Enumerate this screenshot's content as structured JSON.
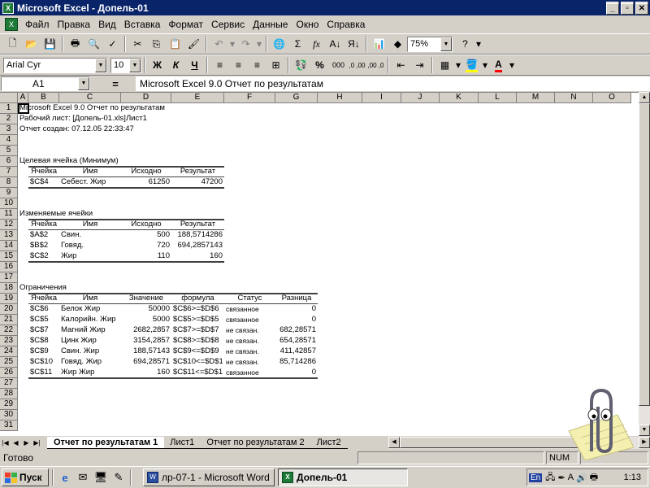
{
  "window": {
    "title": "Microsoft Excel - Допель-01"
  },
  "menu": [
    "Файл",
    "Правка",
    "Вид",
    "Вставка",
    "Формат",
    "Сервис",
    "Данные",
    "Окно",
    "Справка"
  ],
  "toolbar": {
    "zoom": "75%",
    "font_name": "Arial Cyr",
    "font_size": "10",
    "bold": "Ж",
    "italic": "К",
    "underline": "Ч",
    "sum": "Σ",
    "fx": "fx",
    "currency": "%",
    "thousands": "000",
    "inc_dec": ",0 ,00",
    "dec_dec": ",00 ,0",
    "help": "?"
  },
  "formula_bar": {
    "cell_ref": "A1",
    "eq": "=",
    "content": "Microsoft Excel 9.0 Отчет по результатам"
  },
  "columns": [
    "A",
    "B",
    "C",
    "D",
    "E",
    "F",
    "G",
    "H",
    "I",
    "J",
    "K",
    "L",
    "M",
    "N",
    "O"
  ],
  "rows": [
    "1",
    "2",
    "3",
    "4",
    "5",
    "6",
    "7",
    "8",
    "9",
    "10",
    "11",
    "12",
    "13",
    "14",
    "15",
    "16",
    "17",
    "18",
    "19",
    "20",
    "21",
    "22",
    "23",
    "24",
    "25",
    "26",
    "27",
    "28",
    "29",
    "30",
    "31"
  ],
  "report": {
    "line1": "Microsoft Excel 9.0 Отчет по результатам",
    "line2": "Рабочий лист: [Допель-01.xls]Лист1",
    "line3": "Отчет создан: 07.12.05 22:33:47",
    "target_title": "Целевая ячейка (Минимум)",
    "target_headers": [
      "Ячейка",
      "Имя",
      "Исходно",
      "Результат"
    ],
    "target_row": [
      "$C$4",
      "Себест. Жир",
      "61250",
      "47200"
    ],
    "changing_title": "Изменяемые ячейки",
    "changing_headers": [
      "Ячейка",
      "Имя",
      "Исходно",
      "Результат"
    ],
    "changing_rows": [
      [
        "$A$2",
        "Свин.",
        "500",
        "188,5714286"
      ],
      [
        "$B$2",
        "Говяд.",
        "720",
        "694,2857143"
      ],
      [
        "$C$2",
        "Жир",
        "110",
        "160"
      ]
    ],
    "constraints_title": "Ограничения",
    "constraints_headers": [
      "Ячейка",
      "Имя",
      "Значение",
      "формула",
      "Статус",
      "Разница"
    ],
    "constraints_rows": [
      [
        "$C$6",
        "Белок Жир",
        "50000",
        "$C$6>=$D$6",
        "связанное",
        "0"
      ],
      [
        "$C$5",
        "Калорийн. Жир",
        "5000",
        "$C$5>=$D$5",
        "связанное",
        "0"
      ],
      [
        "$C$7",
        "Магний Жир",
        "2682,2857",
        "$C$7>=$D$7",
        "не связан.",
        "682,28571"
      ],
      [
        "$C$8",
        "Цинк Жир",
        "3154,2857",
        "$C$8>=$D$8",
        "не связан.",
        "654,28571"
      ],
      [
        "$C$9",
        "Свин. Жир",
        "188,57143",
        "$C$9<=$D$9",
        "не связан.",
        "411,42857"
      ],
      [
        "$C$10",
        "Говяд. Жир",
        "694,28571",
        "$C$10<=$D$10",
        "не связан.",
        "85,714286"
      ],
      [
        "$C$11",
        "Жир Жир",
        "160",
        "$C$11<=$D$11",
        "связанное",
        "0"
      ]
    ]
  },
  "sheet_tabs": [
    "Отчет по результатам 1",
    "Лист1",
    "Отчет по результатам 2",
    "Лист2"
  ],
  "status": {
    "ready": "Готово",
    "num": "NUM"
  },
  "taskbar": {
    "start": "Пуск",
    "tasks": [
      "лр-07-1 - Microsoft Word",
      "Допель-01"
    ],
    "lang": "En",
    "clock": "1:13"
  }
}
